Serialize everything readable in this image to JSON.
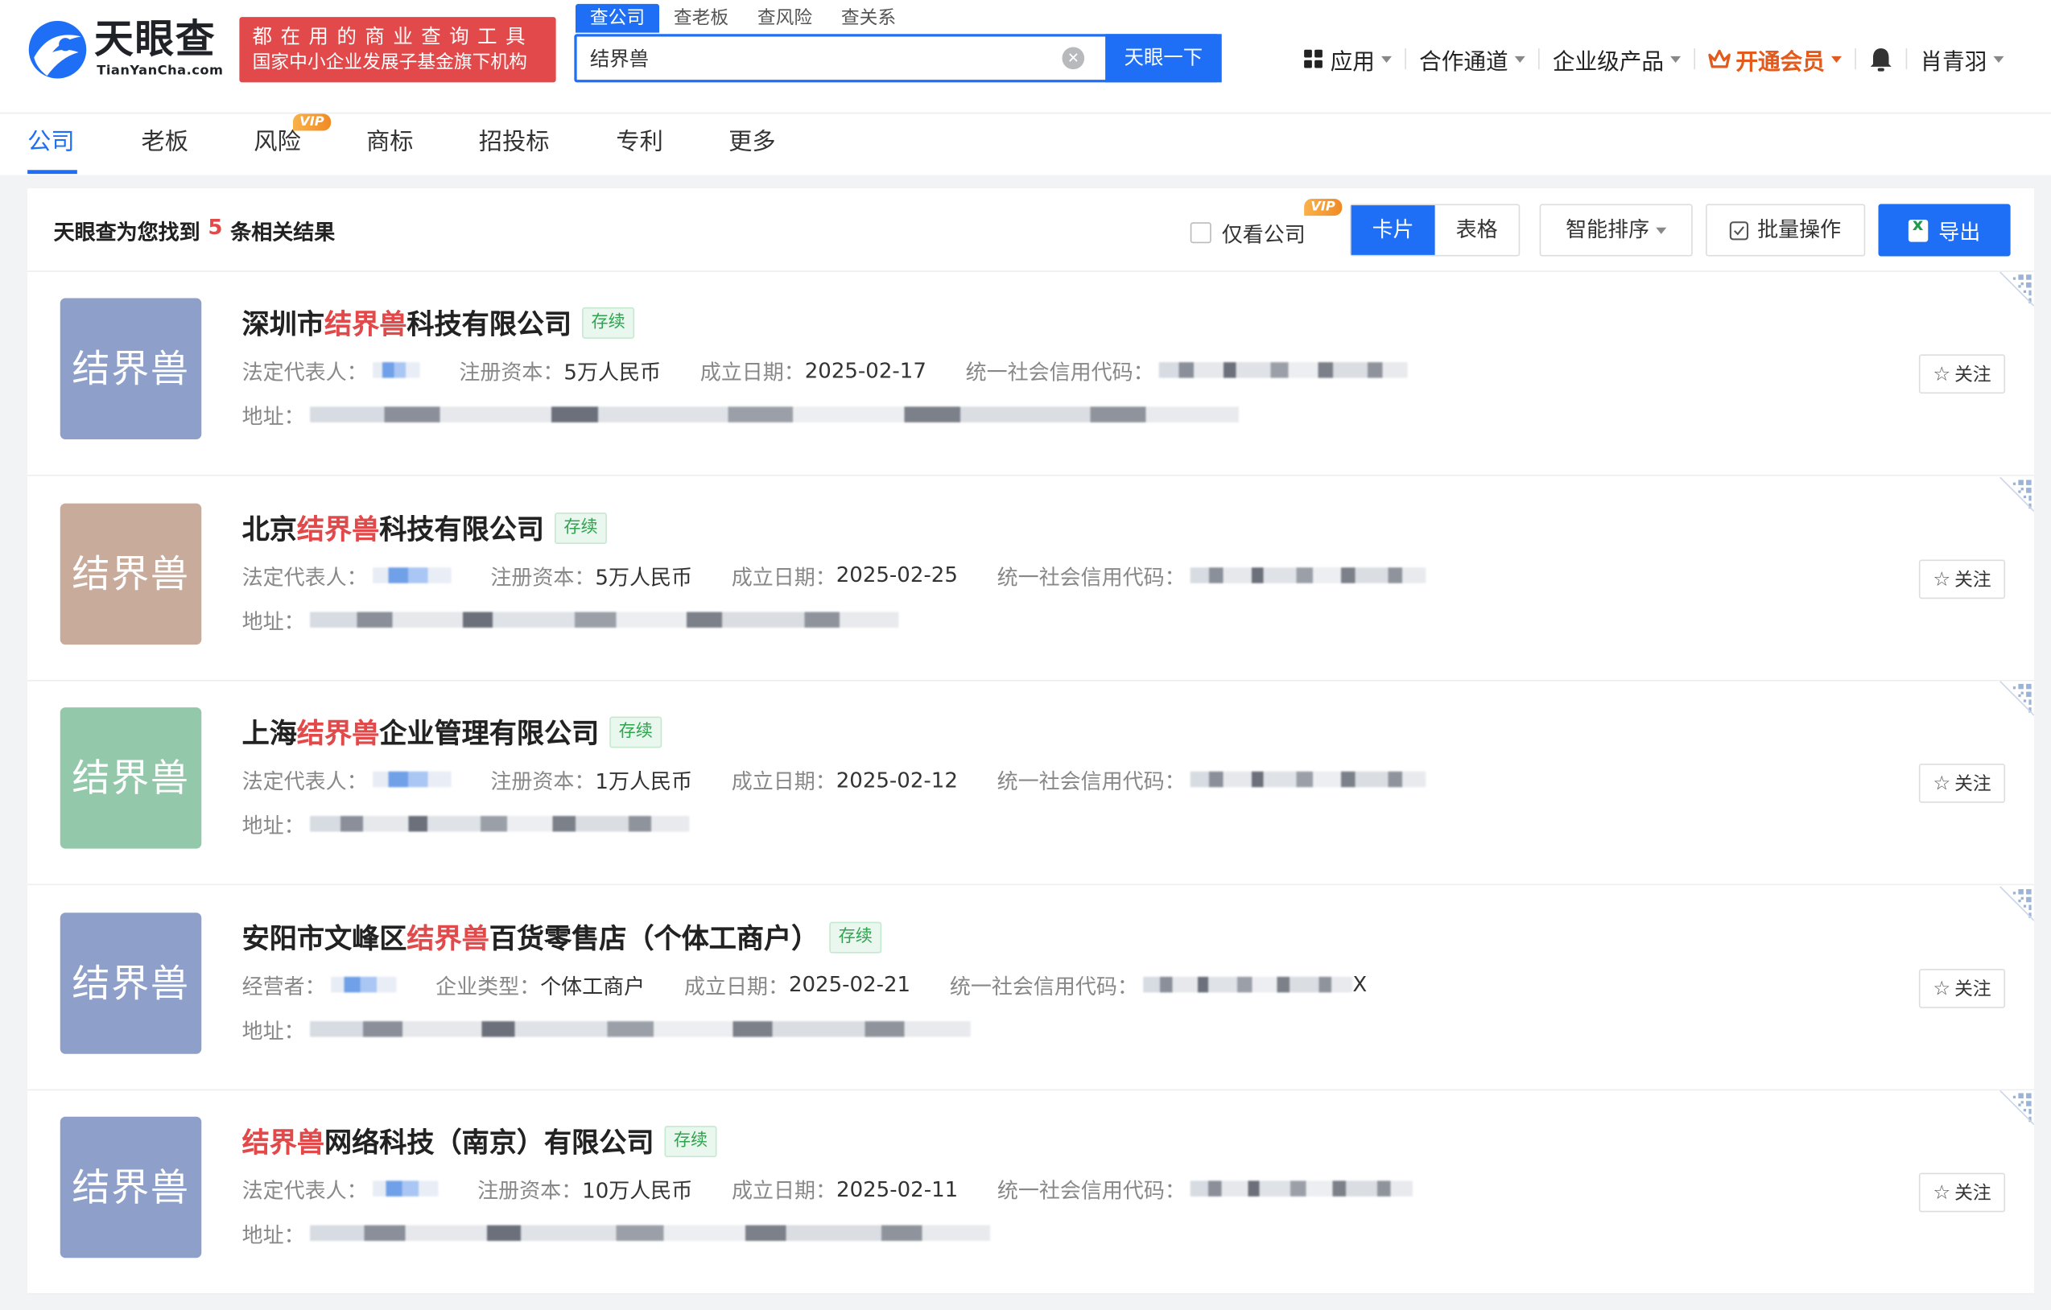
{
  "logo": {
    "name": "天眼查",
    "domain": "TianYanCha.com"
  },
  "slogan": {
    "line1": "都在用的商业查询工具",
    "line2": "国家中小企业发展子基金旗下机构"
  },
  "search": {
    "tabs": [
      "查公司",
      "查老板",
      "查风险",
      "查关系"
    ],
    "value": "结界兽",
    "button": "天眼一下"
  },
  "header_nav": {
    "apps": "应用",
    "partner": "合作通道",
    "enterprise": "企业级产品",
    "vip": "开通会员",
    "user": "肖青羽"
  },
  "category_tabs": [
    "公司",
    "老板",
    "风险",
    "商标",
    "招投标",
    "专利",
    "更多"
  ],
  "vip_badge": "VIP",
  "toolbar": {
    "summary_prefix": "天眼查为您找到",
    "count": "5",
    "summary_suffix": "条相关结果",
    "only_company": "仅看公司",
    "view_card": "卡片",
    "view_table": "表格",
    "sort": "智能排序",
    "batch": "批量操作",
    "export": "导出"
  },
  "follow_label": "关注",
  "results": [
    {
      "logo_text": "结界兽",
      "logo_color": "#8ea0c9",
      "name_pre": "深圳市",
      "name_hl": "结界兽",
      "name_post": "科技有限公司",
      "status": "存续",
      "f1_label": "法定代表人：",
      "f2_label": "注册资本：",
      "f2_value": "5万人民币",
      "f3_label": "成立日期：",
      "f3_value": "2025-02-17",
      "f4_label": "统一社会信用代码：",
      "addr_label": "地址："
    },
    {
      "logo_text": "结界兽",
      "logo_color": "#c9ab9c",
      "name_pre": "北京",
      "name_hl": "结界兽",
      "name_post": "科技有限公司",
      "status": "存续",
      "f1_label": "法定代表人：",
      "f2_label": "注册资本：",
      "f2_value": "5万人民币",
      "f3_label": "成立日期：",
      "f3_value": "2025-02-25",
      "f4_label": "统一社会信用代码：",
      "addr_label": "地址："
    },
    {
      "logo_text": "结界兽",
      "logo_color": "#93c9aa",
      "name_pre": "上海",
      "name_hl": "结界兽",
      "name_post": "企业管理有限公司",
      "status": "存续",
      "f1_label": "法定代表人：",
      "f2_label": "注册资本：",
      "f2_value": "1万人民币",
      "f3_label": "成立日期：",
      "f3_value": "2025-02-12",
      "f4_label": "统一社会信用代码：",
      "addr_label": "地址："
    },
    {
      "logo_text": "结界兽",
      "logo_color": "#8ea0c9",
      "name_pre": "安阳市文峰区",
      "name_hl": "结界兽",
      "name_post": "百货零售店（个体工商户）",
      "status": "存续",
      "f1_label": "经营者：",
      "f2_label": "企业类型：",
      "f2_value": "个体工商户",
      "f3_label": "成立日期：",
      "f3_value": "2025-02-21",
      "f4_label": "统一社会信用代码：",
      "f4_tail": "X",
      "addr_label": "地址："
    },
    {
      "logo_text": "结界兽",
      "logo_color": "#8ea0c9",
      "name_pre": "",
      "name_hl": "结界兽",
      "name_post": "网络科技（南京）有限公司",
      "status": "存续",
      "f1_label": "法定代表人：",
      "f2_label": "注册资本：",
      "f2_value": "10万人民币",
      "f3_label": "成立日期：",
      "f3_value": "2025-02-11",
      "f4_label": "统一社会信用代码：",
      "addr_label": "地址："
    }
  ]
}
